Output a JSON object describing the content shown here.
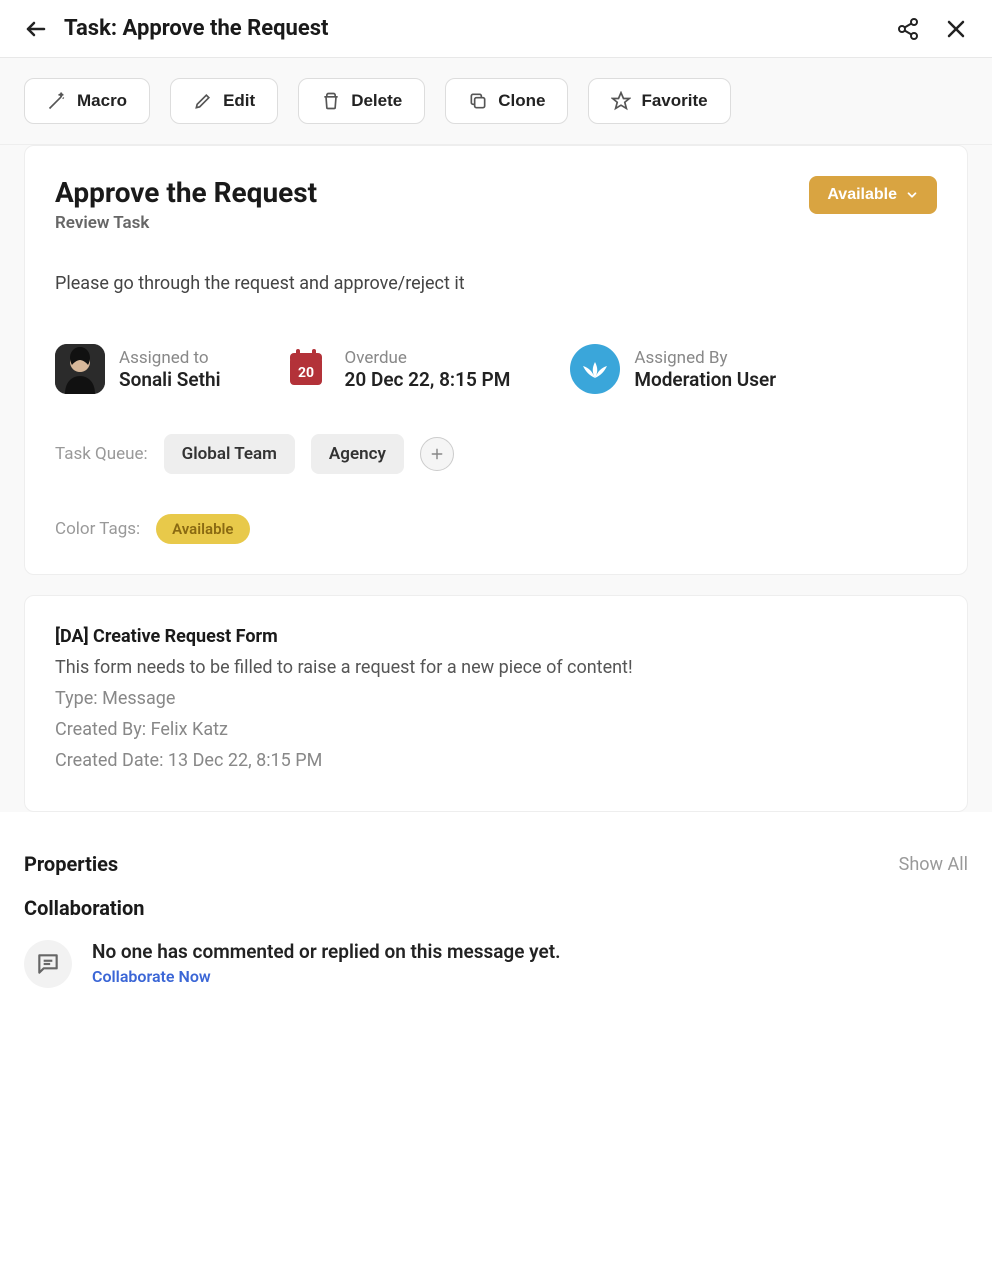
{
  "header": {
    "title": "Task: Approve the Request"
  },
  "toolbar": {
    "macro": "Macro",
    "edit": "Edit",
    "delete": "Delete",
    "clone": "Clone",
    "favorite": "Favorite"
  },
  "task": {
    "title": "Approve the Request",
    "subtitle": "Review Task",
    "status": "Available",
    "description": "Please go through the request and approve/reject it",
    "assigned_to_label": "Assigned to",
    "assigned_to_value": "Sonali Sethi",
    "overdue_label": "Overdue",
    "overdue_value": "20 Dec 22, 8:15 PM",
    "overdue_day": "20",
    "assigned_by_label": "Assigned By",
    "assigned_by_value": "Moderation User",
    "queue_label": "Task Queue:",
    "queues": [
      "Global Team",
      "Agency"
    ],
    "color_tags_label": "Color Tags:",
    "color_tag": "Available"
  },
  "form": {
    "title": "[DA] Creative Request Form",
    "desc": "This form needs to be filled to raise a request for a new piece of content!",
    "type": "Type: Message",
    "created_by": "Created By: Felix Katz",
    "created_date": "Created Date: 13 Dec 22, 8:15 PM"
  },
  "properties": {
    "title": "Properties",
    "show_all": "Show All"
  },
  "collab": {
    "title": "Collaboration",
    "empty": "No one has commented or replied on this message yet.",
    "link": "Collaborate Now"
  }
}
